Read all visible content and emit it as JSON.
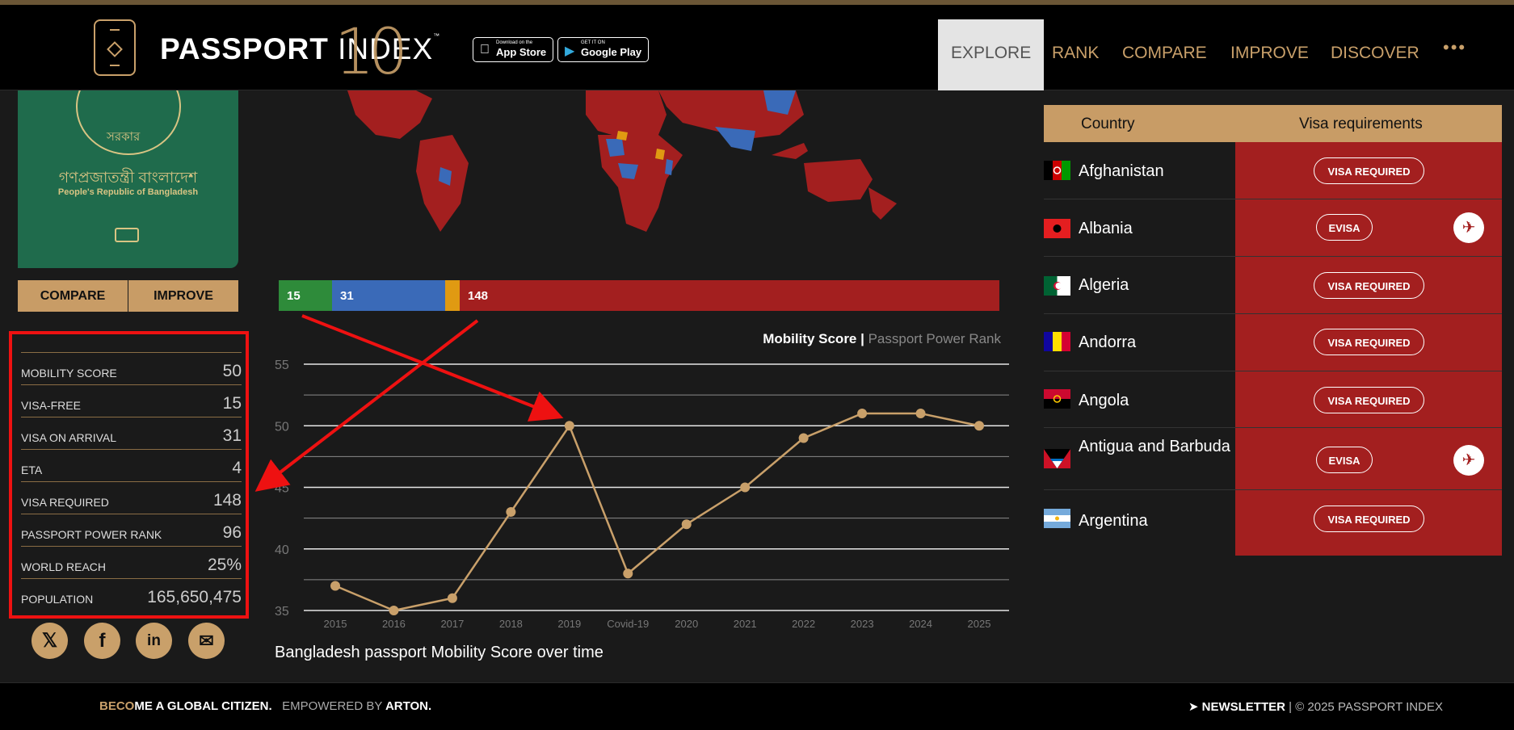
{
  "header": {
    "logo_bold": "PASSPORT",
    "logo_light": "INDEX",
    "logo_tm": "™",
    "logo_anniv": "10",
    "appstore_small": "Download on the",
    "appstore_big": "App Store",
    "googleplay_small": "GET IT ON",
    "googleplay_big": "Google Play",
    "nav": [
      "EXPLORE",
      "RANK",
      "COMPARE",
      "IMPROVE",
      "DISCOVER"
    ],
    "more": "•••"
  },
  "passport": {
    "bn_title": "গণপ্রজাতন্ত্রী বাংলাদেশ",
    "en_title": "People's Republic of Bangladesh",
    "emblem_text": "সরকার"
  },
  "buttons": {
    "compare": "COMPARE",
    "improve": "IMPROVE"
  },
  "stats": [
    {
      "label": "MOBILITY SCORE",
      "value": "50"
    },
    {
      "label": "VISA-FREE",
      "value": "15"
    },
    {
      "label": "VISA ON ARRIVAL",
      "value": "31"
    },
    {
      "label": "ETA",
      "value": "4"
    },
    {
      "label": "VISA REQUIRED",
      "value": "148"
    },
    {
      "label": "PASSPORT POWER RANK",
      "value": "96"
    },
    {
      "label": "WORLD REACH",
      "value": "25%"
    },
    {
      "label": "POPULATION",
      "value": "165,650,475"
    }
  ],
  "social": [
    "x-icon",
    "facebook-icon",
    "linkedin-icon",
    "email-icon"
  ],
  "visa_bar": [
    {
      "label": "15",
      "value": 15,
      "color": "#2e8b3a"
    },
    {
      "label": "31",
      "value": 31,
      "color": "#3a6ab8"
    },
    {
      "label": "",
      "value": 4,
      "color": "#e09a12"
    },
    {
      "label": "148",
      "value": 148,
      "color": "#a31f1f"
    }
  ],
  "chart_legend": {
    "main": "Mobility Score",
    "sep": " | ",
    "sub": "Passport Power Rank"
  },
  "chart_title": "Bangladesh passport Mobility Score over time",
  "chart_data": {
    "type": "line",
    "x": [
      "2015",
      "2016",
      "2017",
      "2018",
      "2019",
      "Covid-19",
      "2020",
      "2021",
      "2022",
      "2023",
      "2024",
      "2025"
    ],
    "series": [
      {
        "name": "Mobility Score",
        "values": [
          37,
          35,
          36,
          43,
          50,
          38,
          42,
          45,
          49,
          51,
          51,
          50
        ]
      }
    ],
    "yticks": [
      55,
      50,
      45,
      40,
      35
    ],
    "ylim": [
      35,
      55
    ],
    "color": "#c9a06a",
    "grid": true
  },
  "table": {
    "col_country": "Country",
    "col_visa": "Visa requirements",
    "rows": [
      {
        "country": "Afghanistan",
        "req": "VISA REQUIRED",
        "plane": false
      },
      {
        "country": "Albania",
        "req": "EVISA",
        "plane": true
      },
      {
        "country": "Algeria",
        "req": "VISA REQUIRED",
        "plane": false
      },
      {
        "country": "Andorra",
        "req": "VISA REQUIRED",
        "plane": false
      },
      {
        "country": "Angola",
        "req": "VISA REQUIRED",
        "plane": false
      },
      {
        "country": "Antigua and Barbuda",
        "req": "EVISA",
        "plane": true
      },
      {
        "country": "Argentina",
        "req": "VISA REQUIRED",
        "plane": false
      }
    ]
  },
  "footer": {
    "become_acc": "BECO",
    "become_rest": "ME A GLOBAL CITIZEN.",
    "powered": "EMPOWERED BY",
    "arton": "ARTON.",
    "newsletter": "NEWSLETTER",
    "copyright": "| © 2025 PASSPORT INDEX"
  }
}
